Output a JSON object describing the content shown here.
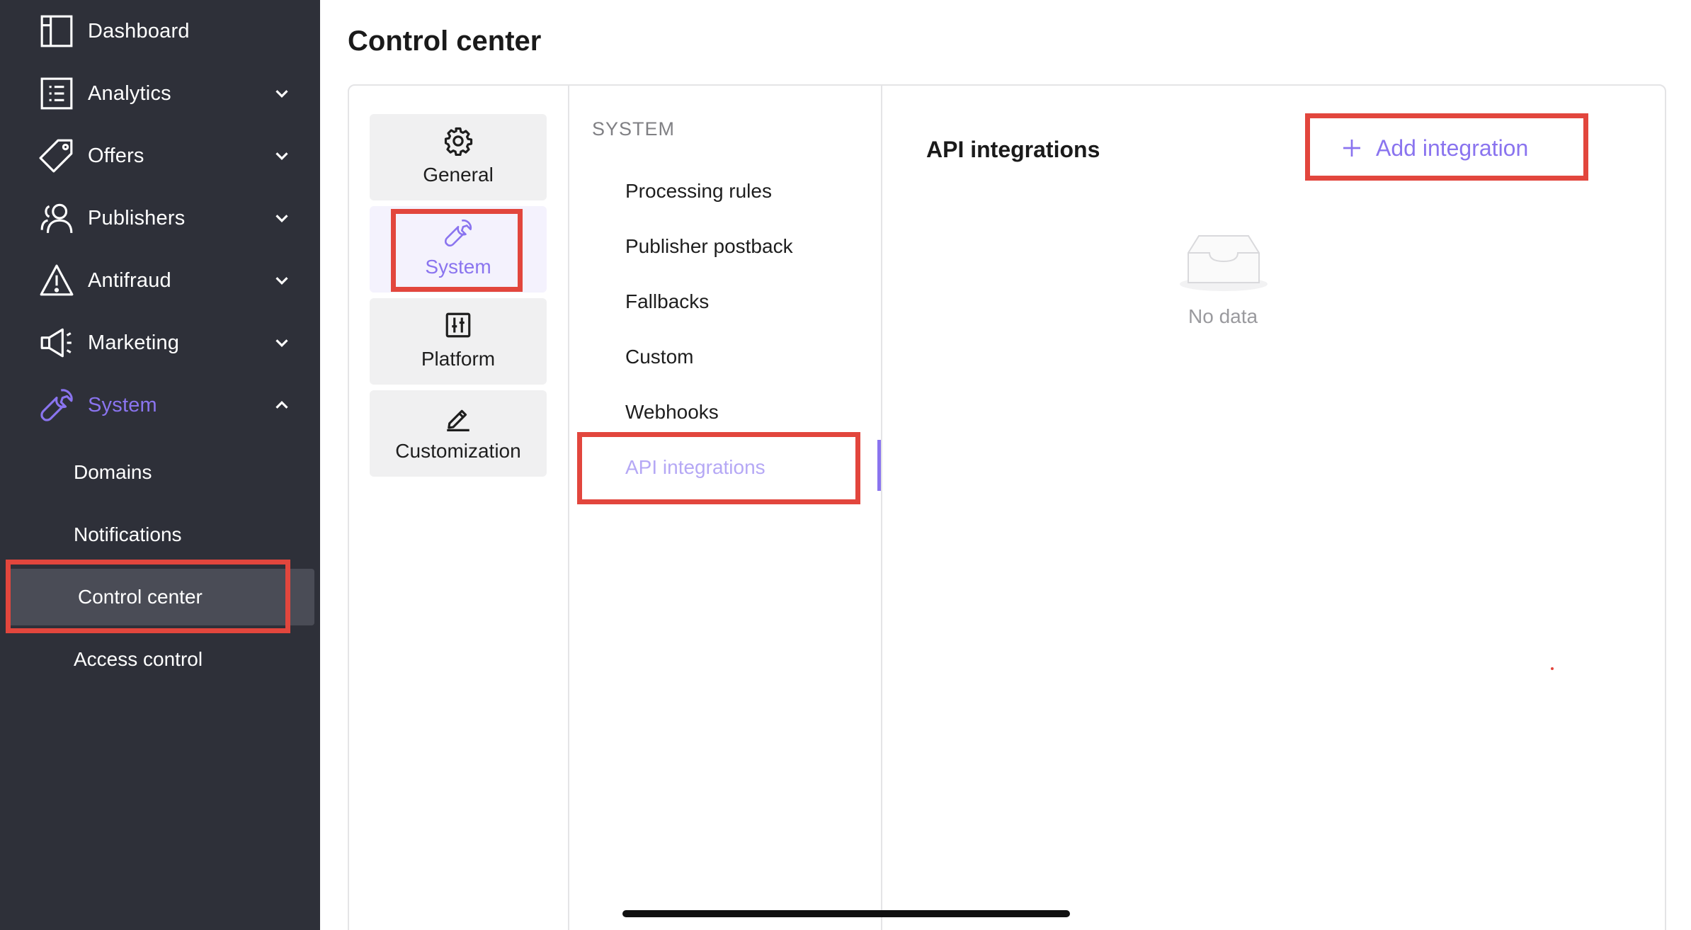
{
  "sidebar": {
    "items": [
      {
        "label": "Dashboard",
        "icon": "dashboard-icon",
        "has_chevron": false
      },
      {
        "label": "Analytics",
        "icon": "analytics-icon",
        "has_chevron": true,
        "chevron": "down"
      },
      {
        "label": "Offers",
        "icon": "tag-icon",
        "has_chevron": true,
        "chevron": "down"
      },
      {
        "label": "Publishers",
        "icon": "users-icon",
        "has_chevron": true,
        "chevron": "down"
      },
      {
        "label": "Antifraud",
        "icon": "warning-icon",
        "has_chevron": true,
        "chevron": "down"
      },
      {
        "label": "Marketing",
        "icon": "megaphone-icon",
        "has_chevron": true,
        "chevron": "down"
      },
      {
        "label": "System",
        "icon": "wrench-icon",
        "has_chevron": true,
        "chevron": "up",
        "active": true
      }
    ],
    "subitems": [
      {
        "label": "Domains"
      },
      {
        "label": "Notifications"
      },
      {
        "label": "Control center",
        "current": true
      },
      {
        "label": "Access control"
      }
    ]
  },
  "page": {
    "title": "Control center"
  },
  "categories": [
    {
      "label": "General",
      "icon": "gear-icon"
    },
    {
      "label": "System",
      "icon": "wrench-icon",
      "selected": true
    },
    {
      "label": "Platform",
      "icon": "sliders-icon"
    },
    {
      "label": "Customization",
      "icon": "pen-icon"
    }
  ],
  "menu": {
    "section": "SYSTEM",
    "items": [
      {
        "label": "Processing rules"
      },
      {
        "label": "Publisher postback"
      },
      {
        "label": "Fallbacks"
      },
      {
        "label": "Custom"
      },
      {
        "label": "Webhooks"
      },
      {
        "label": "API integrations",
        "active": true
      }
    ]
  },
  "content": {
    "title": "API integrations",
    "add_button": "Add integration",
    "empty_text": "No data"
  },
  "colors": {
    "sidebar_bg": "#2e3039",
    "accent": "#8a74ef",
    "highlight": "#e2463d"
  }
}
